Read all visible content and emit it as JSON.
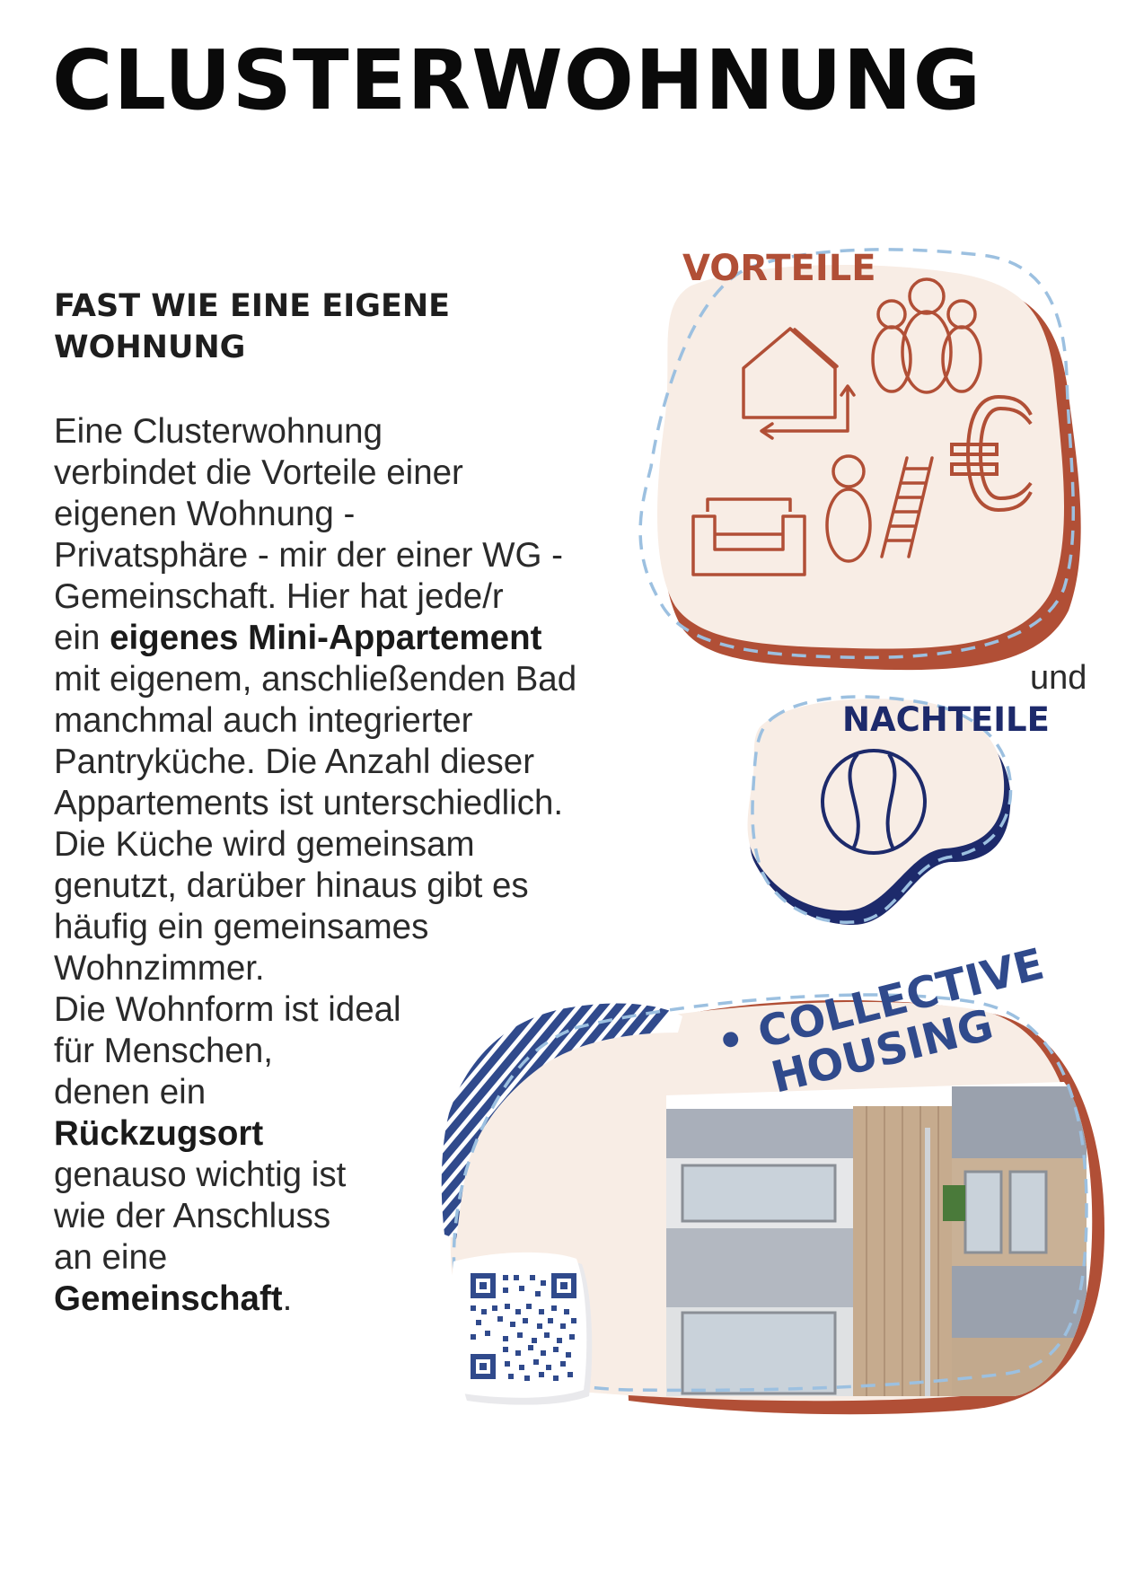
{
  "page": {
    "title": "CLUSTERWOHNUNG",
    "subtitle_line1": "FAST WIE EINE EIGENE",
    "subtitle_line2": "WOHNUNG"
  },
  "body": {
    "l1": "Eine Clusterwohnung",
    "l2": "verbindet die Vorteile einer",
    "l3": "eigenen Wohnung -",
    "l4": "Privatsphäre - mir der einer WG -",
    "l5": "Gemeinschaft. Hier hat jede/r",
    "l6_pre": "ein ",
    "l6_bold": "eigenes Mini-Appartement",
    "l7": "mit eigenem, anschließenden Bad",
    "l8": "manchmal auch integrierter",
    "l9": "Pantryküche. Die Anzahl dieser",
    "l10": "Appartements ist unterschiedlich.",
    "l11": "Die Küche wird gemeinsam",
    "l12": "genutzt, darüber hinaus gibt es",
    "l13": "häufig ein gemeinsames",
    "l14": "Wohnzimmer.",
    "l15": "Die Wohnform ist ideal",
    "l16": "für Menschen,",
    "l17": "denen ein",
    "l18_bold": "Rückzugsort",
    "l19": "genauso wichtig ist",
    "l20": "wie der Anschluss",
    "l21": "an eine",
    "l22_bold": "Gemeinschaft",
    "l22_post": "."
  },
  "vorteile": {
    "heading": "VORTEILE"
  },
  "connector": {
    "und": "und"
  },
  "nachteile": {
    "heading": "NACHTEILE"
  },
  "collective": {
    "line1": "• COLLECTIVE",
    "line2": "HOUSING"
  },
  "icons": {
    "vorteile": [
      "house-cycle-icon",
      "family-icon",
      "euro-icon",
      "person-icon",
      "ladder-icon",
      "sofa-icon"
    ],
    "nachteile": [
      "ball-icon"
    ],
    "collective": [
      "qr-code-icon",
      "building-photo"
    ]
  },
  "colors": {
    "rust": "#b14f36",
    "navy": "#1d2a6b",
    "blue": "#304a8c",
    "cream": "#f8ede5",
    "dashed": "#9cc0e0"
  }
}
